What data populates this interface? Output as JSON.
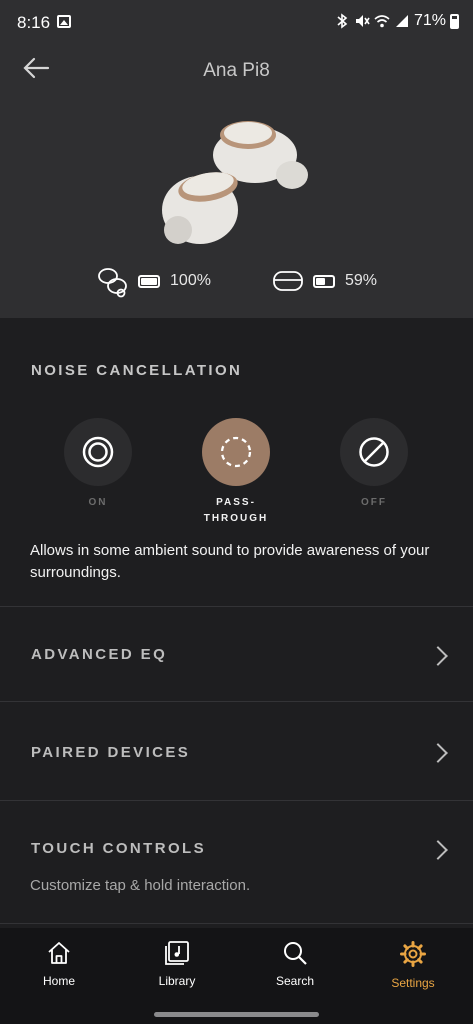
{
  "status_bar": {
    "time": "8:16",
    "battery": "71%",
    "icons": [
      "photo-icon",
      "bluetooth-icon",
      "mute-icon",
      "wifi-icon",
      "signal-icon",
      "battery-icon"
    ]
  },
  "header": {
    "title": "Ana Pi8",
    "back_icon": "arrow-left-icon"
  },
  "batteries": {
    "earbuds": {
      "label": "100%",
      "level": 1.0
    },
    "case": {
      "label": "59%",
      "level": 0.59
    }
  },
  "noise_cancellation": {
    "title": "NOISE CANCELLATION",
    "options": [
      {
        "label": "ON",
        "icon": "anc-on-icon",
        "active": false
      },
      {
        "label": "PASS-\nTHROUGH",
        "icon": "passthrough-icon",
        "active": true
      },
      {
        "label": "OFF",
        "icon": "anc-off-icon",
        "active": false
      }
    ],
    "description": "Allows in some ambient sound to provide awareness of your surroundings."
  },
  "settings_rows": {
    "advanced_eq": "ADVANCED EQ",
    "paired_devices": "PAIRED DEVICES",
    "touch_controls": "TOUCH CONTROLS",
    "touch_controls_sub": "Customize tap & hold interaction."
  },
  "bottom_nav": {
    "items": [
      {
        "label": "Home",
        "icon": "home-icon"
      },
      {
        "label": "Library",
        "icon": "library-icon"
      },
      {
        "label": "Search",
        "icon": "search-icon"
      },
      {
        "label": "Settings",
        "icon": "gear-icon"
      }
    ],
    "active_color": "#e9a543"
  },
  "colors": {
    "accent": "#9c7c66",
    "background": "#1e1e20",
    "header_bg": "#2f2f31"
  }
}
